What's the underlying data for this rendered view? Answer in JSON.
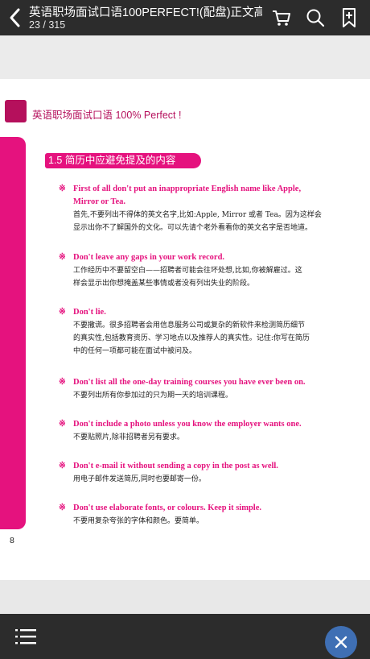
{
  "header": {
    "title": "英语职场面试口语100PERFECT!(配盘)正文高",
    "page_counter": "23 / 315"
  },
  "icons": {
    "back": "chevron-left-icon",
    "cart": "cart-icon",
    "search": "search-icon",
    "bookmark": "bookmark-add-icon",
    "menu": "list-menu-icon",
    "close": "close-icon"
  },
  "colors": {
    "accent": "#e5127e",
    "header_square": "#b5105c",
    "bar": "#2c2c2c",
    "fab": "#3f6fb4"
  },
  "page": {
    "book_header": "英语职场面试口语 100% Perfect !",
    "section_title": "1.5  简历中应避免提及的内容",
    "page_number": "8",
    "items": [
      {
        "mark": "※",
        "en": "First of all don't put an inappropriate English name like Apple,",
        "en2": "Mirror or Tea.",
        "cn1": "首先,不要列出不得体的英文名字,比如:Apple, Mirror 或者 Tea。因为这样会",
        "cn2": "显示出你不了解国外的文化。可以先请个老外看看你的英文名字是否地道。"
      },
      {
        "mark": "※",
        "en": "Don't leave any gaps in your work record.",
        "cn1": "工作经历中不要留空白——招聘者可能会往坏处想,比如,你被解雇过。这",
        "cn2": "样会显示出你想掩盖某些事情或者没有列出失业的阶段。"
      },
      {
        "mark": "※",
        "en": "Don't lie.",
        "cn1": "不要撒谎。很多招聘者会用信息服务公司或复杂的新软件来检测简历细节",
        "cn2": "的真实性,包括教育资历、学习地点以及推荐人的真实性。记住:你写在简历",
        "cn3": "中的任何一项都可能在面试中被问及。"
      },
      {
        "mark": "※",
        "en": "Don't list all the one-day training courses you have ever been on.",
        "cn1": "不要列出所有你参加过的只为期一天的培训课程。"
      },
      {
        "mark": "※",
        "en": "Don't include a photo unless you know the employer wants one.",
        "cn1": "不要贴照片,除非招聘者另有要求。"
      },
      {
        "mark": "※",
        "en": "Don't e-mail it without sending a copy in the post as well.",
        "cn1": "用电子邮件发送简历,同时也要邮寄一份。"
      },
      {
        "mark": "※",
        "en": "Don't use elaborate fonts, or colours.  Keep it simple.",
        "cn1": "不要用复杂夸张的字体和颜色。要简单。"
      }
    ]
  }
}
